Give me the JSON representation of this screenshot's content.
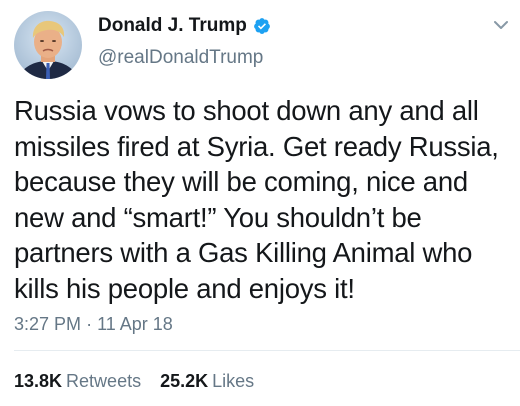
{
  "user": {
    "display_name": "Donald J. Trump",
    "handle": "@realDonaldTrump",
    "verified": true,
    "verified_color": "#1da1f2"
  },
  "tweet": {
    "lines": [
      "Russia vows to shoot down any and all",
      "missiles fired at Syria. Get ready Russia,",
      "because they will be coming, nice and",
      "new and “smart!” You shouldn’t be",
      "partners with a Gas Killing Animal who",
      "kills his people and enjoys it!"
    ],
    "time": "3:27 PM",
    "separator": "·",
    "date": "11 Apr 18"
  },
  "stats": {
    "retweets_count": "13.8K",
    "retweets_label": "Retweets",
    "likes_count": "25.2K",
    "likes_label": "Likes"
  },
  "icons": {
    "avatar": "avatar-photo",
    "verified": "verified-badge-icon",
    "menu": "chevron-down-icon"
  },
  "colors": {
    "text": "#14171a",
    "secondary": "#657786",
    "divider": "#e6ecf0"
  }
}
